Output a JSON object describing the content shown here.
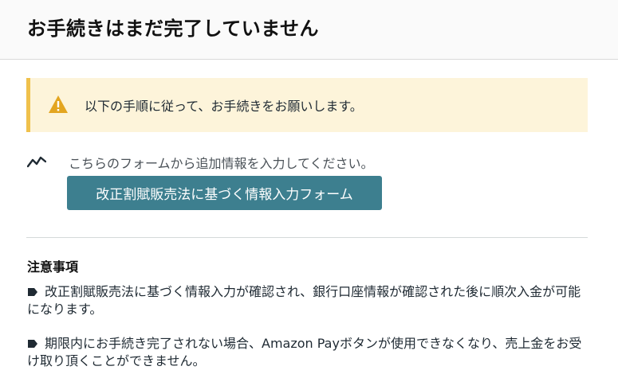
{
  "header": {
    "title": "お手続きはまだ完了していません"
  },
  "alert": {
    "icon": "warning-icon",
    "text": "以下の手順に従って、お手続きをお願いします。",
    "accent_color": "#f0c14b",
    "background_color": "#fdf4da"
  },
  "form_step": {
    "icon": "trend-line-icon",
    "note": "こちらのフォームから追加情報を入力してください。",
    "button_label": "改正割賦販売法に基づく情報入力フォーム",
    "button_color": "#3d7f8f"
  },
  "notes": {
    "title": "注意事項",
    "items": [
      {
        "icon": "tag-icon",
        "text": "改正割賦販売法に基づく情報入力が確認され、銀行口座情報が確認された後に順次入金が可能になります。"
      },
      {
        "icon": "tag-icon",
        "text": "期限内にお手続き完了されない場合、Amazon Payボタンが使用できなくなり、売上金をお受け取り頂くことができません。"
      }
    ]
  }
}
